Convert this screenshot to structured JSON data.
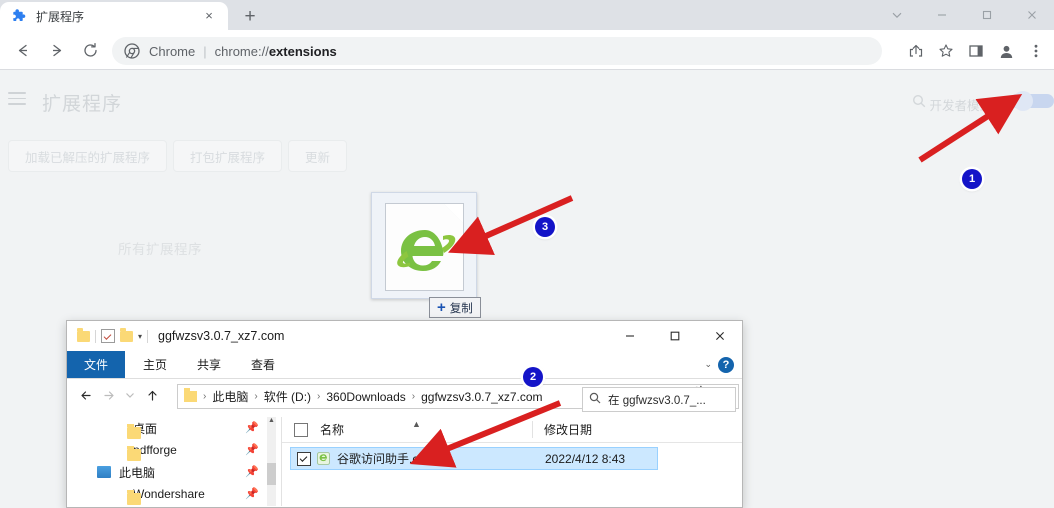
{
  "browser": {
    "tab": {
      "title": "扩展程序",
      "favicon": "puzzle-icon",
      "close": "×"
    },
    "new_tab": "+",
    "window_controls": {
      "chevron": "⌄",
      "minimize": "–",
      "maximize": "☐",
      "close": "✕"
    },
    "omnibox": {
      "chrome_label": "Chrome",
      "separator": "|",
      "url_prefix": "chrome://",
      "url_bold": "extensions"
    },
    "toolbar_icons": [
      "share-icon",
      "bookmark-star-icon",
      "side-panel-icon",
      "profile-avatar-icon",
      "more-menu-icon"
    ],
    "nav_icons": [
      "back-icon",
      "forward-icon",
      "reload-icon"
    ]
  },
  "extensions_page": {
    "menu_label": "menu-icon",
    "title": "扩展程序",
    "search_icon": "search-icon",
    "dev_mode_label": "开发者模式",
    "dev_mode_on": true,
    "buttons": [
      "加载已解压的扩展程序",
      "打包扩展程序",
      "更新"
    ],
    "section_label": "所有扩展程序"
  },
  "drag": {
    "tooltip_plus": "+",
    "tooltip_label": "复制",
    "icon": "ie-green-e-icon"
  },
  "file_explorer": {
    "title": "ggfwzsv3.0.7_xz7.com",
    "quick_access": [
      "folder-icon",
      "checkbox-icon",
      "folder-icon",
      "dropdown-caret-icon"
    ],
    "window_controls": {
      "minimize": "–",
      "maximize": "☐",
      "close": "✕"
    },
    "ribbon_tabs": [
      "文件",
      "主页",
      "共享",
      "查看"
    ],
    "ribbon_caret": "⌄",
    "help_label": "?",
    "address": {
      "crumbs": [
        "此电脑",
        "软件 (D:)",
        "360Downloads",
        "ggfwzsv3.0.7_xz7.com"
      ],
      "separator": "›",
      "dropdown": "⌄",
      "refresh": "↻"
    },
    "search": {
      "icon": "search-icon",
      "text": "在 ggfwzsv3.0.7_..."
    },
    "sidebar": [
      {
        "label": "桌面",
        "icon": "folder-icon",
        "pin": "pin-icon"
      },
      {
        "label": "pdfforge",
        "icon": "folder-icon",
        "pin": "pin-icon"
      },
      {
        "label": "此电脑",
        "icon": "computer-icon",
        "pin": "pin-icon"
      },
      {
        "label": "Wondershare",
        "icon": "folder-icon",
        "pin": "pin-icon"
      }
    ],
    "columns": [
      "名称",
      "修改日期"
    ],
    "rows": [
      {
        "name": "谷歌访问助手.crx",
        "date": "2022/4/12 8:43",
        "icon": "crx-file-icon",
        "checked": true,
        "selected": true
      }
    ]
  },
  "annotations": {
    "badges": [
      {
        "number": "1"
      },
      {
        "number": "2"
      },
      {
        "number": "3"
      }
    ],
    "arrow_color": "#d92020"
  }
}
